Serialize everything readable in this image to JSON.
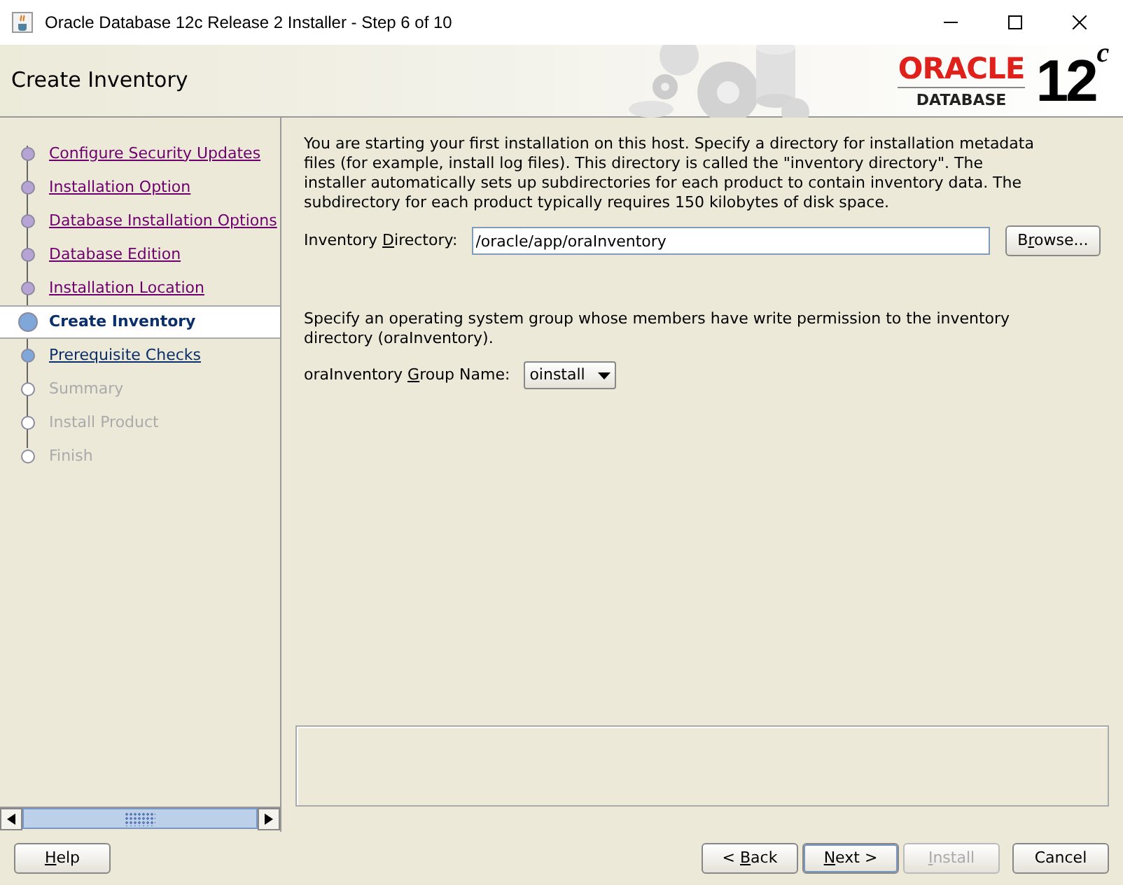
{
  "window": {
    "title": "Oracle Database 12c Release 2 Installer - Step 6 of 10"
  },
  "header": {
    "title": "Create Inventory",
    "logo": {
      "brand": "ORACLE",
      "product": "DATABASE",
      "version": "12",
      "version_suffix": "c"
    }
  },
  "steps": [
    {
      "label": "Configure Security Updates",
      "kind": "done",
      "selected": false
    },
    {
      "label": "Installation Option",
      "kind": "done",
      "selected": false
    },
    {
      "label": "Database Installation Options",
      "kind": "done",
      "selected": false
    },
    {
      "label": "Database Edition",
      "kind": "done",
      "selected": false
    },
    {
      "label": "Installation Location",
      "kind": "done",
      "selected": false
    },
    {
      "label": "Create Inventory",
      "kind": "current",
      "selected": true
    },
    {
      "label": "Prerequisite Checks",
      "kind": "available",
      "selected": false
    },
    {
      "label": "Summary",
      "kind": "pending",
      "selected": false
    },
    {
      "label": "Install Product",
      "kind": "pending",
      "selected": false
    },
    {
      "label": "Finish",
      "kind": "pending",
      "selected": false
    }
  ],
  "content": {
    "intro": "You are starting your first installation on this host. Specify a directory for installation metadata files (for example, install log files). This directory is called the \"inventory directory\". The installer automatically sets up subdirectories for each product to contain inventory data. The subdirectory for each product typically requires 150 kilobytes of disk space.",
    "inventory_directory": {
      "label": {
        "before": "Inventory ",
        "key": "D",
        "after": "irectory:"
      },
      "value": "/oracle/app/oraInventory",
      "browse": {
        "before": "B",
        "key": "r",
        "after": "owse..."
      }
    },
    "group_text": "Specify an operating system group whose members have write permission to the inventory directory (oraInventory).",
    "group": {
      "label": {
        "before": "oraInventory ",
        "key": "G",
        "after": "roup Name:"
      },
      "value": "oinstall"
    }
  },
  "buttons": [
    {
      "label": {
        "key": "H",
        "after": "elp"
      },
      "disabled": false,
      "default": false
    },
    {
      "label": {
        "before": "< ",
        "key": "B",
        "after": "ack"
      },
      "disabled": false,
      "default": false
    },
    {
      "label": {
        "key": "N",
        "after": "ext >"
      },
      "disabled": false,
      "default": true
    },
    {
      "label": {
        "key": "I",
        "after": "nstall"
      },
      "disabled": true,
      "default": false
    },
    {
      "label": {
        "before": "Cancel"
      },
      "disabled": false,
      "default": false
    }
  ]
}
